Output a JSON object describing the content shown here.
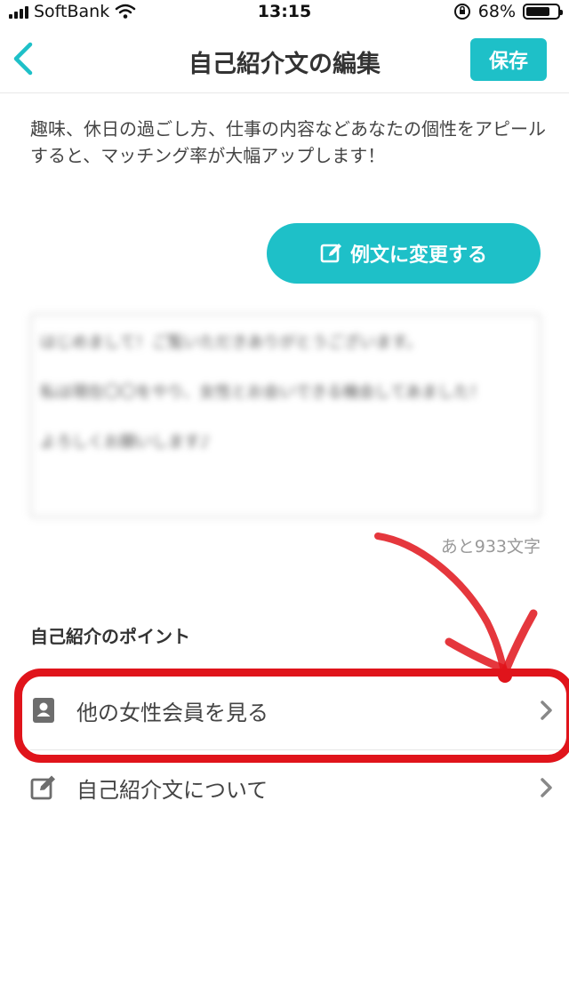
{
  "status_bar": {
    "carrier": "SoftBank",
    "time": "13:15",
    "battery": "68%",
    "battery_level": 0.68
  },
  "header": {
    "title": "自己紹介文の編集",
    "save_label": "保存",
    "back_icon": "chevron-left-icon"
  },
  "description": "趣味、休日の過ごし方、仕事の内容などあなたの個性をアピールすると、マッチング率が大幅アップします！",
  "example_button": {
    "label": "例文に変更する",
    "icon": "edit-icon"
  },
  "textarea": {
    "value": "はじめまして！ご覧いただきありがとうございます。\n\n私は現在〇〇をやり、女性とお会いできる機会してあました！\n\nよろしくお願いします♪"
  },
  "char_count": "あと933文字",
  "section": {
    "title": "自己紹介のポイント"
  },
  "list": [
    {
      "label": "他の女性会員を見る",
      "icon": "profile-book-icon"
    },
    {
      "label": "自己紹介文について",
      "icon": "edit-icon"
    }
  ],
  "colors": {
    "accent": "#1ec0c8",
    "annotation": "#e0141b"
  }
}
